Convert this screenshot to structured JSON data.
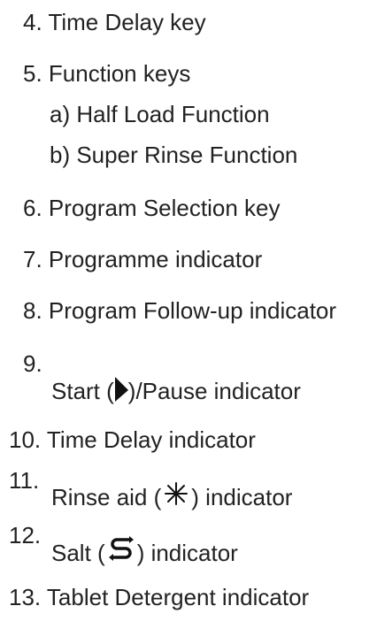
{
  "items": [
    {
      "num": "4.",
      "text": "Time Delay key"
    },
    {
      "num": "5.",
      "text": "Function keys"
    },
    {
      "text": "a) Half Load Function"
    },
    {
      "text": "b) Super Rinse Function"
    },
    {
      "num": "6.",
      "text": "Program Selection key"
    },
    {
      "num": "7.",
      "text": "Programme indicator"
    },
    {
      "num": "8.",
      "text": "Program Follow-up indicator"
    },
    {
      "num": "9.",
      "pre": "Start (",
      "icon": "play-arrow-icon",
      "post": ")/Pause indicator"
    },
    {
      "num": "10.",
      "text": "Time Delay indicator"
    },
    {
      "num": "11.",
      "pre": "Rinse aid (",
      "icon": "rinse-aid-sparkle-icon",
      "post": ") indicator"
    },
    {
      "num": "12.",
      "pre": "Salt (",
      "icon": "salt-arrows-icon",
      "post": ") indicator"
    },
    {
      "num": "13.",
      "text": "Tablet Detergent indicator"
    }
  ]
}
